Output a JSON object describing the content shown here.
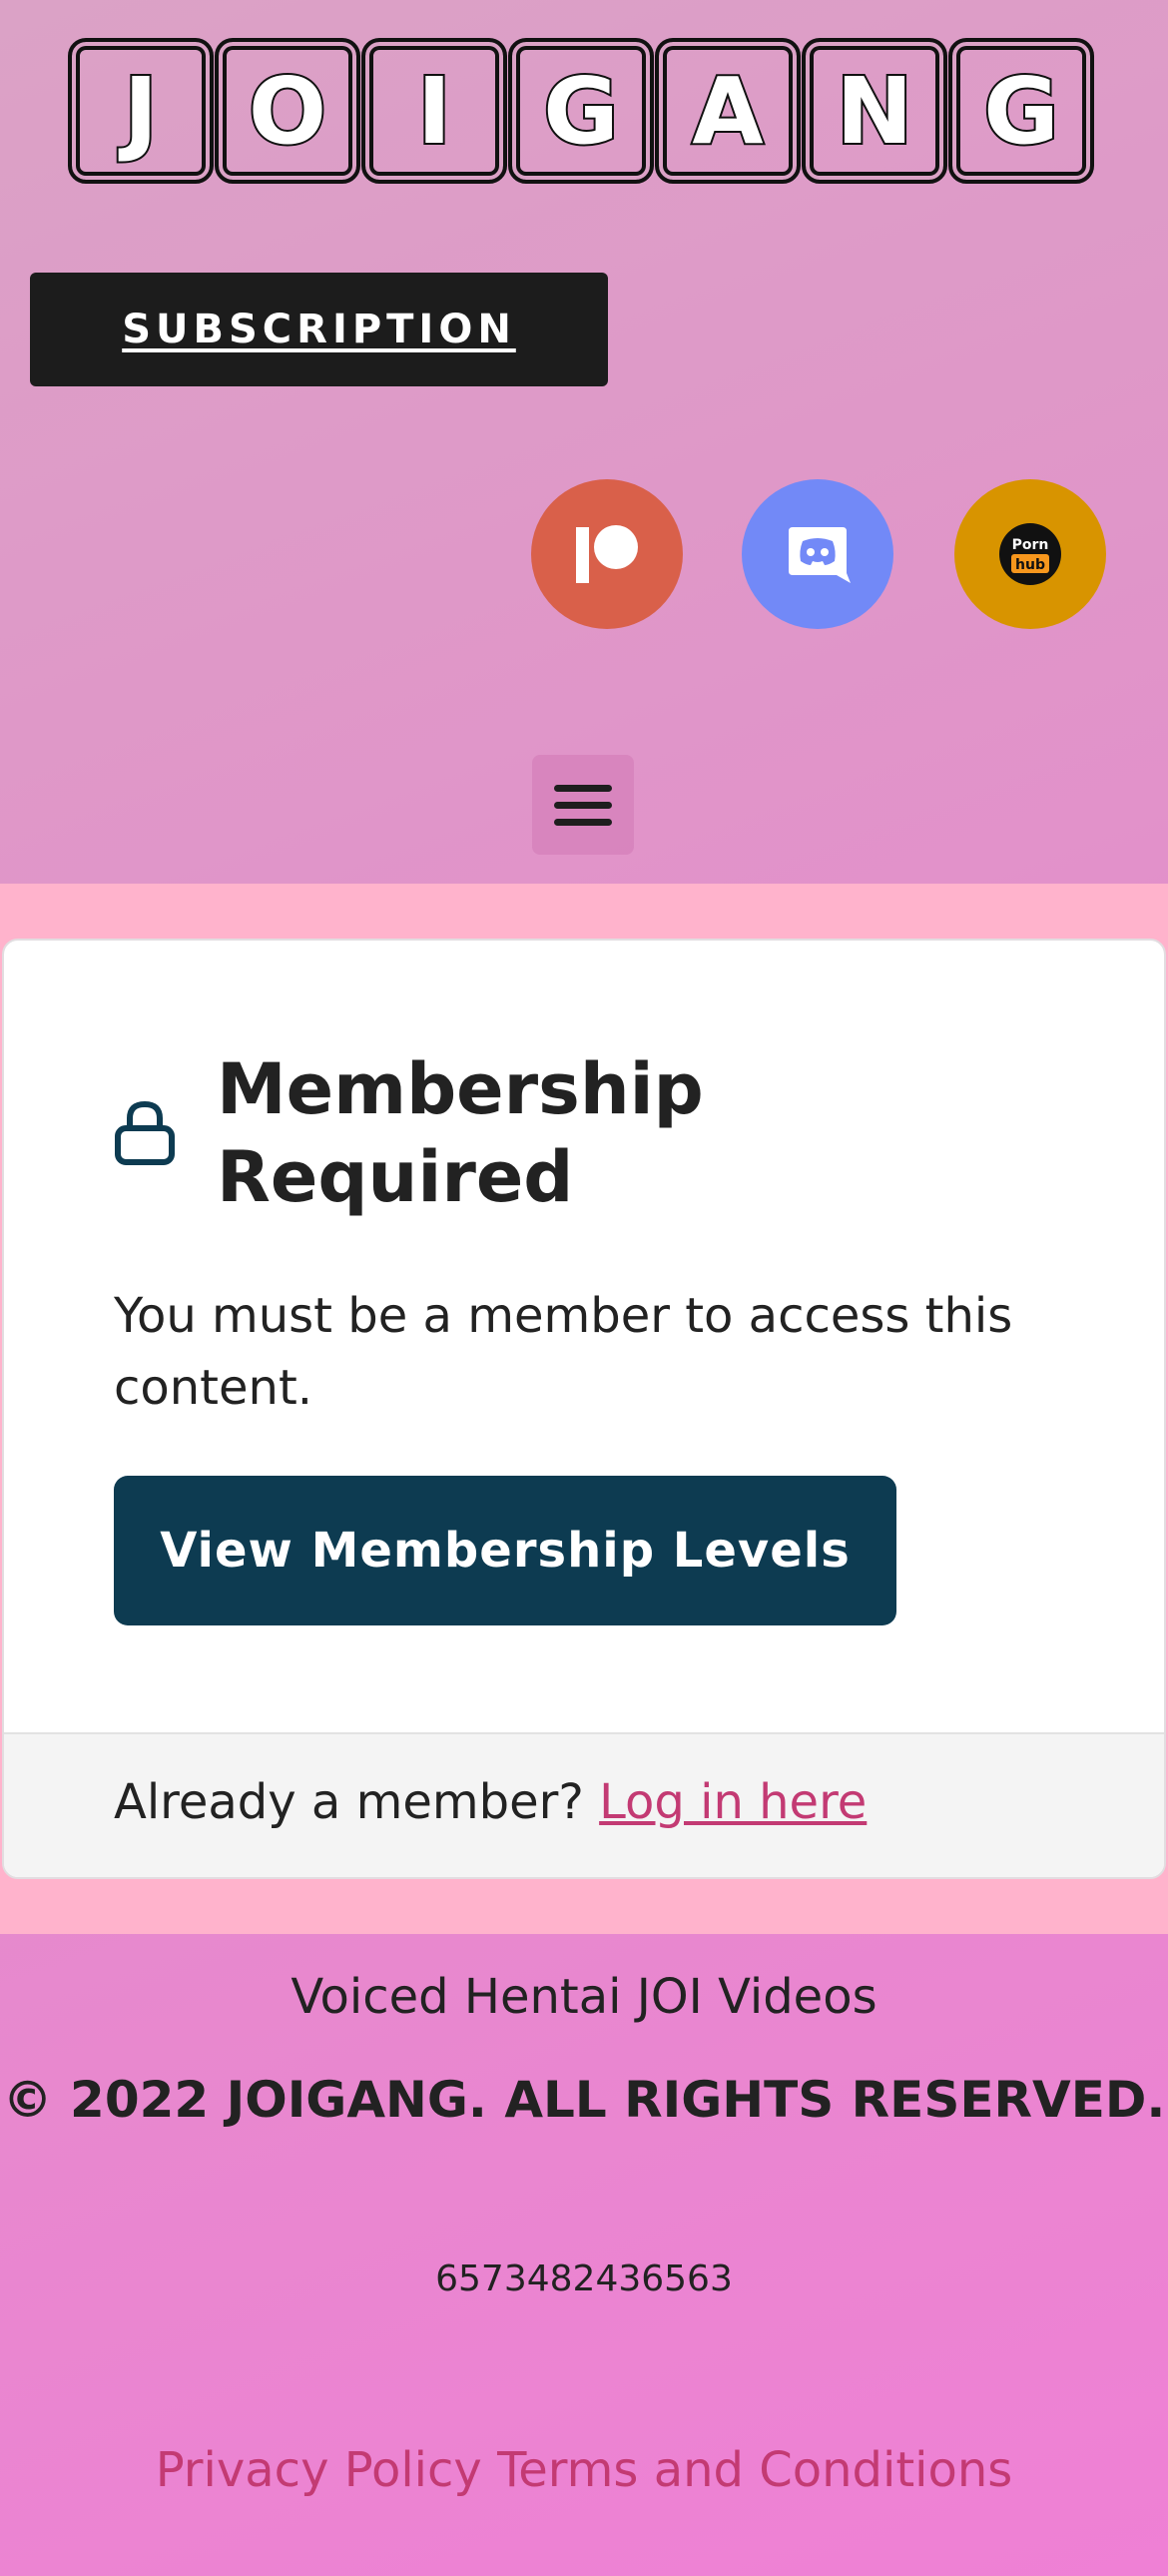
{
  "header": {
    "logo_letters": [
      "J",
      "O",
      "I",
      "G",
      "A",
      "N",
      "G"
    ],
    "subscription_label": "SUBSCRIPTION",
    "social": {
      "patreon": {
        "icon": "patreon-icon",
        "color": "#d9604a"
      },
      "discord": {
        "icon": "discord-icon",
        "color": "#7289f7"
      },
      "pornhub": {
        "icon": "pornhub-icon",
        "color": "#d89400",
        "text_top": "Porn",
        "text_bottom": "hub"
      }
    },
    "menu_icon": "hamburger-menu-icon"
  },
  "card": {
    "title": "Membership Required",
    "message": "You must be a member to access this content.",
    "button_label": "View Membership Levels",
    "footer_prefix": "Already a member?",
    "footer_link": "Log in here",
    "accent_color": "#0d3b51",
    "link_color": "#c33a73"
  },
  "footer": {
    "tagline": "Voiced Hentai JOI Videos",
    "copyright": "© 2022 JOIGANG. ALL RIGHTS RESERVED.",
    "number": "6573482436563",
    "privacy": "Privacy Policy",
    "terms": "Terms and Conditions"
  }
}
